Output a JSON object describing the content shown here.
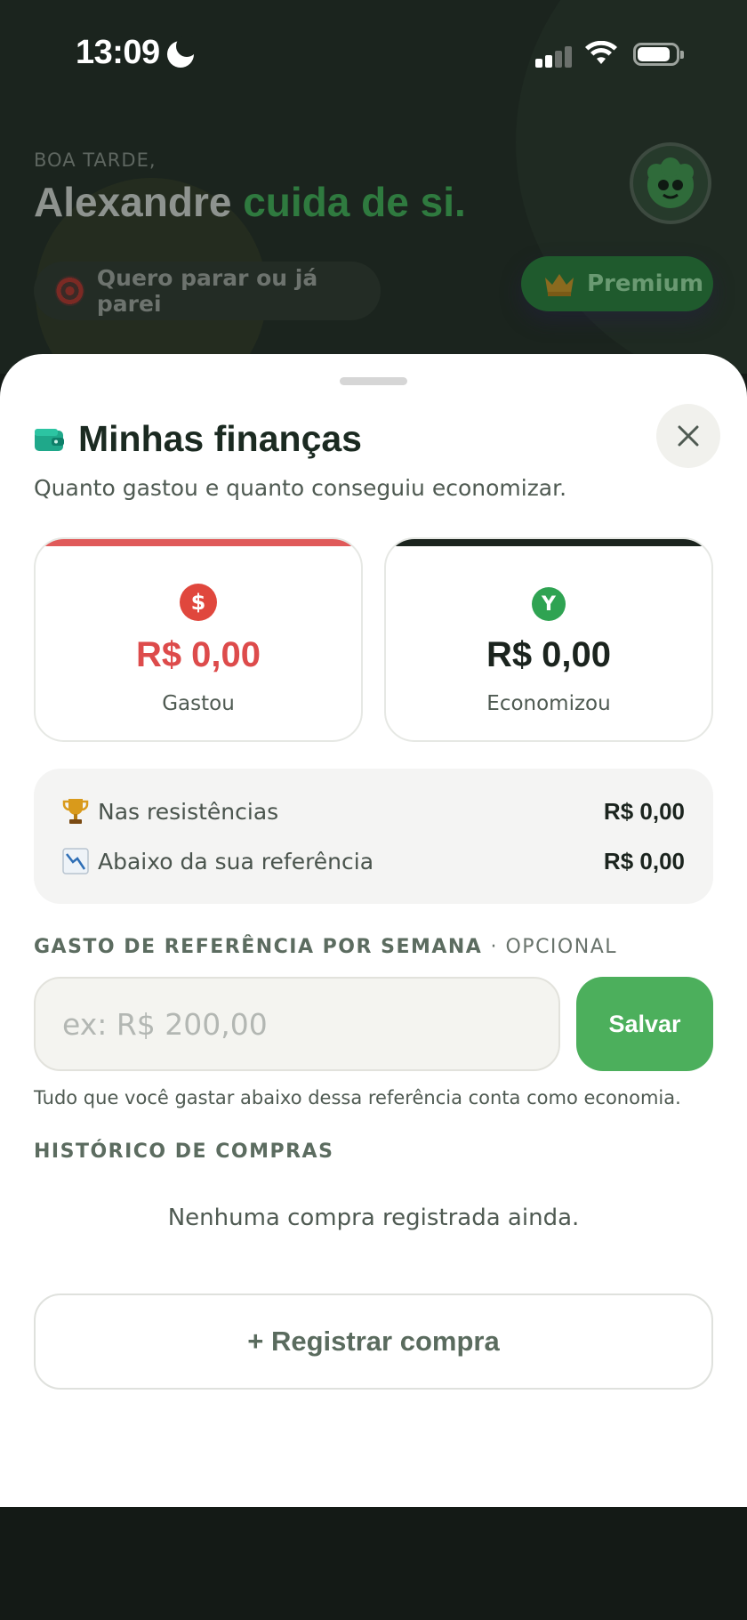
{
  "status_bar": {
    "time": "13:09"
  },
  "background": {
    "greeting_small": "BOA TARDE,",
    "name": "Alexandre",
    "tagline": "cuida de si.",
    "goal_pill_label": "Quero parar ou já parei",
    "premium_label": "Premium"
  },
  "sheet": {
    "title": "Minhas finanças",
    "subtitle": "Quanto gastou e quanto conseguiu economizar.",
    "spent": {
      "icon_glyph": "$",
      "value": "R$ 0,00",
      "label": "Gastou"
    },
    "saved": {
      "icon_glyph": "Y",
      "value": "R$ 0,00",
      "label": "Economizou"
    },
    "summary": [
      {
        "label": "Nas resistências",
        "value": "R$ 0,00",
        "icon": "trophy-icon"
      },
      {
        "label": "Abaixo da sua referência",
        "value": "R$ 0,00",
        "icon": "chart-decreasing-icon"
      }
    ],
    "reference": {
      "label": "GASTO DE REFERÊNCIA POR SEMANA",
      "optional": "· OPCIONAL",
      "placeholder": "ex: R$ 200,00",
      "value": "",
      "save_label": "Salvar",
      "helper": "Tudo que você gastar abaixo dessa referência conta como economia."
    },
    "history": {
      "label": "HISTÓRICO DE COMPRAS",
      "empty": "Nenhuma compra registrada ainda."
    },
    "register_label": "+ Registrar compra"
  },
  "colors": {
    "accent_green": "#4caf5c",
    "spent_red": "#dd4b4b",
    "dark": "#1b241e"
  }
}
